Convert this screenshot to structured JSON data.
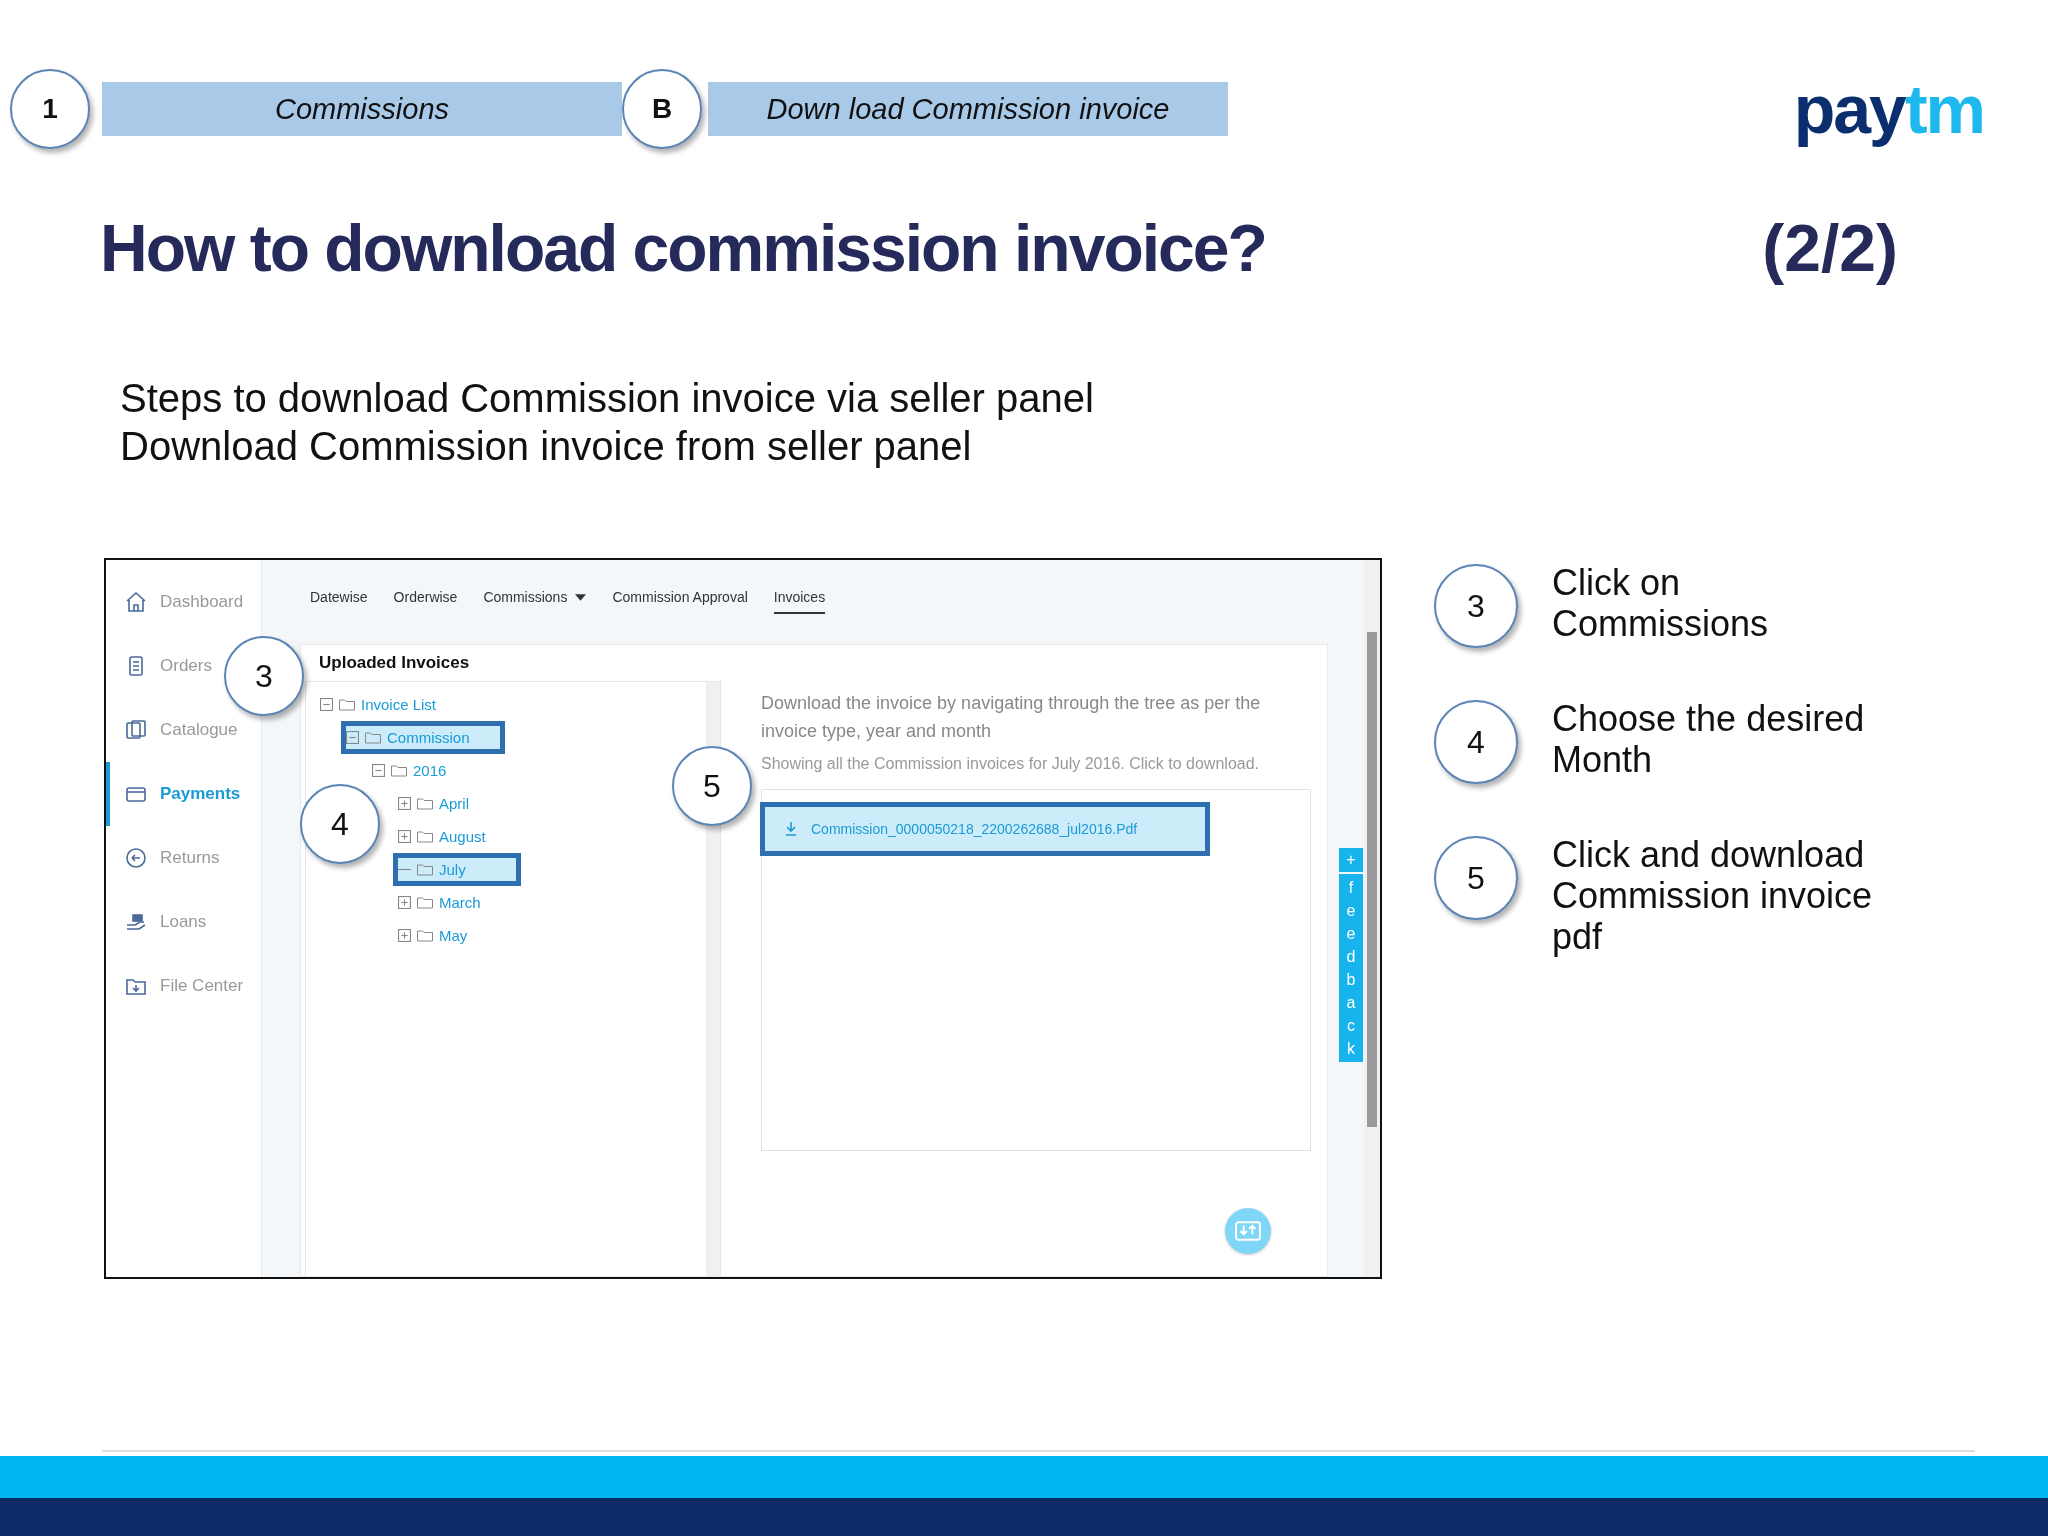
{
  "header": {
    "step_number": "1",
    "section": "Commissions",
    "sub_step": "B",
    "sub_section": "Down load Commission invoice",
    "logo": {
      "dark": "pay",
      "light": "tm"
    }
  },
  "title": "How to download commission invoice?",
  "page_count": "(2/2)",
  "subtitle": [
    "Steps to download Commission invoice via seller panel",
    "Download Commission invoice  from seller panel"
  ],
  "screenshot": {
    "sidebar": [
      {
        "label": "Dashboard",
        "selected": false
      },
      {
        "label": "Orders",
        "selected": false
      },
      {
        "label": "Catalogue",
        "selected": false
      },
      {
        "label": "Payments",
        "selected": true
      },
      {
        "label": "Returns",
        "selected": false
      },
      {
        "label": "Loans",
        "selected": false
      },
      {
        "label": "File Center",
        "selected": false
      }
    ],
    "tabs": [
      {
        "label": "Datewise",
        "selected": false,
        "dropdown": false
      },
      {
        "label": "Orderwise",
        "selected": false,
        "dropdown": false
      },
      {
        "label": "Commissions",
        "selected": false,
        "dropdown": true
      },
      {
        "label": "Commission Approval",
        "selected": false,
        "dropdown": false
      },
      {
        "label": "Invoices",
        "selected": true,
        "dropdown": false
      }
    ],
    "panel_title": "Uploaded Invoices",
    "tree": [
      {
        "label": "Invoice List",
        "kind": "branch",
        "expanded": true,
        "highlighted": false,
        "children": [
          {
            "label": "Commission",
            "kind": "branch",
            "expanded": true,
            "highlighted": true,
            "children": [
              {
                "label": "2016",
                "kind": "branch",
                "expanded": true,
                "highlighted": false,
                "children": [
                  {
                    "label": "April",
                    "kind": "branch",
                    "expanded": false,
                    "highlighted": false
                  },
                  {
                    "label": "August",
                    "kind": "branch",
                    "expanded": false,
                    "highlighted": false
                  },
                  {
                    "label": "July",
                    "kind": "leaf",
                    "highlighted": true
                  },
                  {
                    "label": "March",
                    "kind": "branch",
                    "expanded": false,
                    "highlighted": false
                  },
                  {
                    "label": "May",
                    "kind": "branch",
                    "expanded": false,
                    "highlighted": false
                  }
                ]
              }
            ]
          }
        ]
      }
    ],
    "description": "Download the invoice by navigating through the tree as per the invoice type, year and month",
    "showing": "Showing all the Commission invoices for July 2016. Click to download.",
    "files": [
      {
        "name": "Commission_0000050218_2200262688_jul2016.Pdf",
        "highlighted": true
      }
    ],
    "feedback_plus": "+",
    "feedback": "feedback",
    "callouts": [
      "3",
      "4",
      "5"
    ]
  },
  "steps": [
    {
      "number": "3",
      "text": "Click on Commissions"
    },
    {
      "number": "4",
      "text": "Choose the desired Month"
    },
    {
      "number": "5",
      "text": "Click and download Commission invoice pdf"
    }
  ]
}
